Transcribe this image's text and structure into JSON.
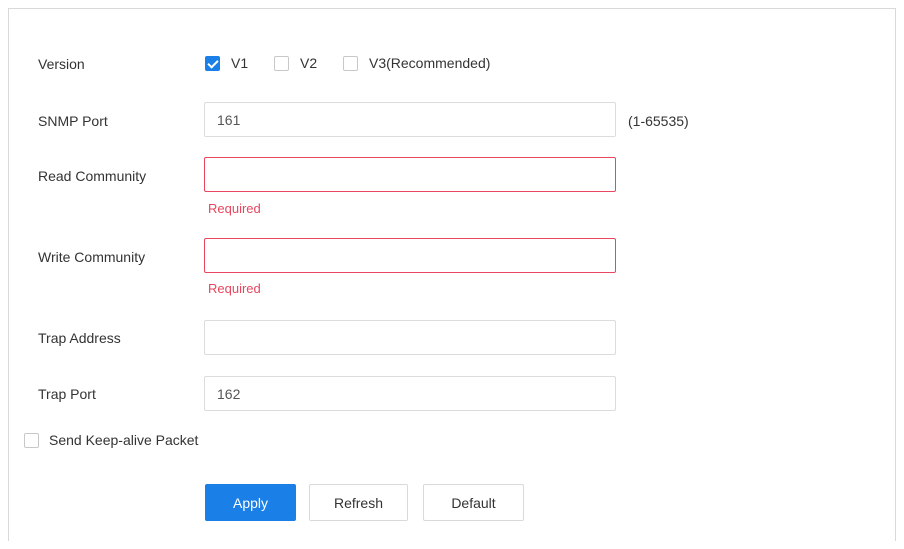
{
  "version": {
    "label": "Version",
    "options": [
      {
        "label": "V1",
        "checked": true
      },
      {
        "label": "V2",
        "checked": false
      },
      {
        "label": "V3(Recommended)",
        "checked": false
      }
    ]
  },
  "snmp_port": {
    "label": "SNMP Port",
    "value": "161",
    "hint": "(1-65535)"
  },
  "read_community": {
    "label": "Read Community",
    "value": "",
    "error": "Required"
  },
  "write_community": {
    "label": "Write Community",
    "value": "",
    "error": "Required"
  },
  "trap_address": {
    "label": "Trap Address",
    "value": ""
  },
  "trap_port": {
    "label": "Trap Port",
    "value": "162"
  },
  "keep_alive": {
    "label": "Send Keep-alive Packet",
    "checked": false
  },
  "buttons": {
    "apply": "Apply",
    "refresh": "Refresh",
    "default": "Default"
  },
  "colors": {
    "primary": "#1a7fe6",
    "error": "#e8475f"
  }
}
